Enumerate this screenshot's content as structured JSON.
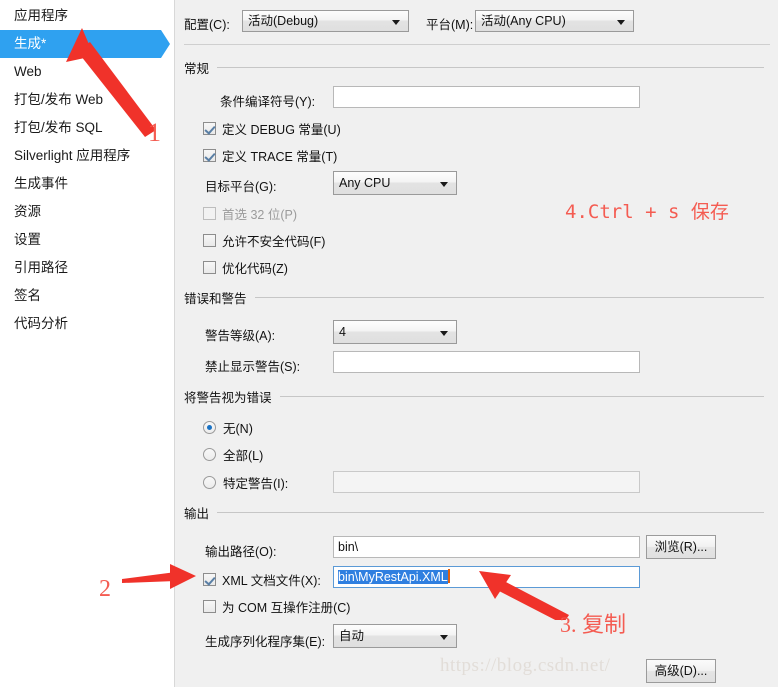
{
  "sidebar": {
    "items": [
      {
        "label": "应用程序",
        "selected": false
      },
      {
        "label": "生成*",
        "selected": true
      },
      {
        "label": "Web",
        "selected": false
      },
      {
        "label": "打包/发布 Web",
        "selected": false
      },
      {
        "label": "打包/发布 SQL",
        "selected": false
      },
      {
        "label": "Silverlight 应用程序",
        "selected": false
      },
      {
        "label": "生成事件",
        "selected": false
      },
      {
        "label": "资源",
        "selected": false
      },
      {
        "label": "设置",
        "selected": false
      },
      {
        "label": "引用路径",
        "selected": false
      },
      {
        "label": "签名",
        "selected": false
      },
      {
        "label": "代码分析",
        "selected": false
      }
    ]
  },
  "config_row": {
    "configuration_label": "配置(C):",
    "configuration_value": "活动(Debug)",
    "platform_label": "平台(M):",
    "platform_value": "活动(Any CPU)"
  },
  "general": {
    "group_title": "常规",
    "conditional_symbols_label": "条件编译符号(Y):",
    "conditional_symbols_value": "",
    "define_debug_label": "定义 DEBUG 常量(U)",
    "define_debug_checked": true,
    "define_trace_label": "定义 TRACE 常量(T)",
    "define_trace_checked": true,
    "target_platform_label": "目标平台(G):",
    "target_platform_value": "Any CPU",
    "prefer32_label": "首选 32 位(P)",
    "prefer32_checked": false,
    "allow_unsafe_label": "允许不安全代码(F)",
    "allow_unsafe_checked": false,
    "optimize_label": "优化代码(Z)",
    "optimize_checked": false
  },
  "errors_warnings": {
    "group_title": "错误和警告",
    "warning_level_label": "警告等级(A):",
    "warning_level_value": "4",
    "suppress_warnings_label": "禁止显示警告(S):",
    "suppress_warnings_value": ""
  },
  "treat_warnings": {
    "group_title": "将警告视为错误",
    "none_label": "无(N)",
    "none_selected": true,
    "all_label": "全部(L)",
    "all_selected": false,
    "specific_label": "特定警告(I):",
    "specific_selected": false,
    "specific_value": ""
  },
  "output": {
    "group_title": "输出",
    "output_path_label": "输出路径(O):",
    "output_path_value": "bin\\",
    "browse_label": "浏览(R)...",
    "xml_doc_label": "XML 文档文件(X):",
    "xml_doc_checked": true,
    "xml_doc_value": "bin\\MyRestApi.XML",
    "register_com_label": "为 COM 互操作注册(C)",
    "register_com_checked": false,
    "serialization_label": "生成序列化程序集(E):",
    "serialization_value": "自动",
    "advanced_label": "高级(D)..."
  },
  "annotations": {
    "step1": "1",
    "step2": "2",
    "step3": "3. 复制",
    "step4": "4.Ctrl + s 保存",
    "accent_color": "#f45c52"
  },
  "watermark": {
    "text": "https://blog.csdn.net/"
  }
}
